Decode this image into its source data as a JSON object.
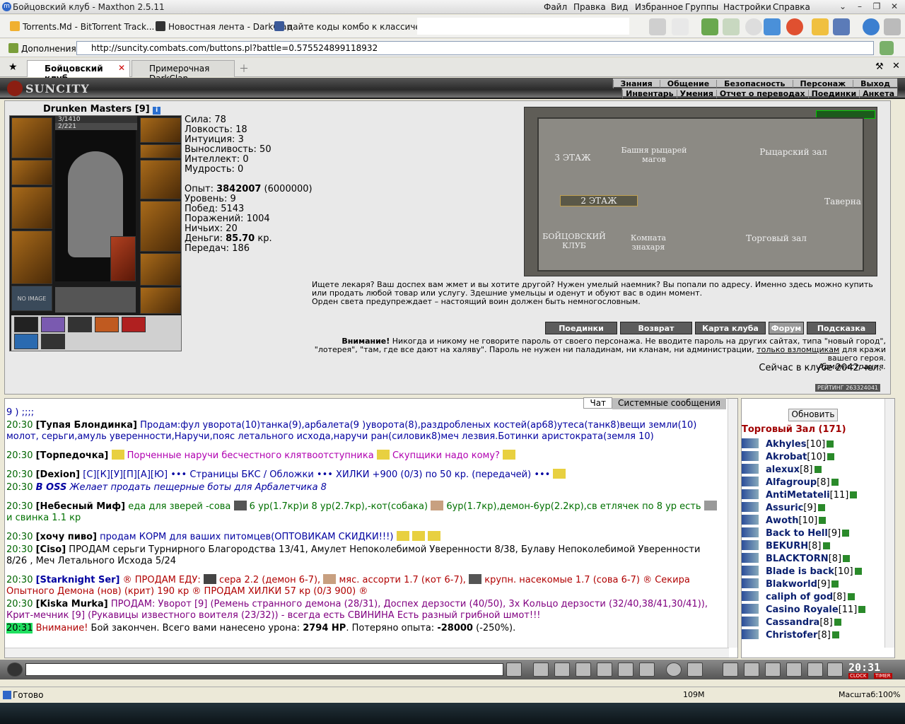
{
  "window": {
    "title": "Бойцовский клуб - Maxthon 2.5.11",
    "menu": [
      "Файл",
      "Правка",
      "Вид",
      "Избранное",
      "Группы",
      "Настройки",
      "Справка"
    ]
  },
  "favorites": [
    "Torrents.Md - BitTorrent Track...",
    "Новостная лента - DarkClan",
    "дайте коды комбо к классическо..."
  ],
  "addressbar": {
    "addons": "Дополнения",
    "url": "http://suncity.combats.com/buttons.pl?battle=0.575524899118932"
  },
  "tabs": [
    "Бойцовский клуб",
    "Примерочная DarkClan"
  ],
  "game": {
    "logo": "SUNCITY",
    "nav_top": [
      "Знания",
      "Общение",
      "Безопасность",
      "Персонаж",
      "Выход"
    ],
    "nav_sub": [
      "Инвентарь",
      "Умения",
      "Отчет о переводах",
      "Поединки",
      "Анкета"
    ]
  },
  "character": {
    "name": "Drunken Masters [9]",
    "hp": "3/1410",
    "mp": "2/221",
    "no_image": "NO IMAGE",
    "stats": [
      "Сила: 78",
      "Ловкость: 18",
      "Интуиция: 3",
      "Выносливость: 50",
      "Интеллект: 0",
      "Мудрость: 0"
    ],
    "exp_label": "Опыт: ",
    "exp_value": "3842007",
    "exp_next": " (6000000)",
    "level": "Уровень: 9",
    "wins": "Побед: 5143",
    "losses": "Поражений: 1004",
    "draws": "Ничьих: 20",
    "money_label": "Деньги: ",
    "money_value": "85.70",
    "money_unit": " кр.",
    "transfers": "Передач: 186"
  },
  "map": {
    "rooms": [
      "3 ЭТАЖ",
      "Башня рыцарей магов",
      "Рыцарский зал",
      "2 ЭТАЖ",
      "Таверна",
      "БОЙЦОВСКИЙ КЛУБ",
      "Комната знахаря",
      "Торговый зал"
    ]
  },
  "description": {
    "line1": "Ищете лекаря? Ваш доспех вам жмет и вы хотите другой? Нужен умелый наемник? Вы попали по адресу. Именно здесь можно купить или продать любой товар или услугу. Здешние умельцы и оденут и обуют вас в один момент.",
    "line2": "Орден света предупреждает – настоящий воин должен быть немногословным."
  },
  "buttons": [
    "Поединки",
    "Возврат",
    "Карта клуба",
    "Форум",
    "Подсказка"
  ],
  "warning": {
    "bold": "Внимание!",
    "text": " Никогда и никому не говорите пароль от своего персонажа. Не вводите пароль на других сайтах, типа \"новый город\", \"лотерея\", \"там, где все дают на халяву\". Пароль не нужен ни паладинам, ни кланам, ни администрации, ",
    "link": "только взломщикам",
    "tail": " для кражи вашего героя.",
    "sign": "Администрация."
  },
  "online": "Сейчас в клубе 2042 чел.",
  "rating": "РЕЙТИНГ 263324041",
  "chat": {
    "tabs": [
      "Чат",
      "Системные сообщения"
    ],
    "messages": [
      {
        "time": "",
        "nick": "",
        "text": "9 ) ;;;;"
      },
      {
        "time": "20:30",
        "nick": "[Тупая Блондинка]",
        "text": " Продам:фул уворота(10)танка(9),арбалета(9 )уворота(8),раздробленых костей(ар68)утеса(танк8)вещи земли(10) молот, серьги,амуль уверенности,Наручи,пояс летального исхода,наручи ран(силовик8)меч лезвия.Ботинки аристократа(земля 10)"
      },
      {
        "time": "20:30",
        "nick": "[Торпедочка]",
        "text": " Порченные наручи бесчестного клятвоотступника",
        "text2": " Скупщики надо кому?"
      },
      {
        "time": "20:30",
        "nick": "[Dexion]",
        "text": " [С][К][У][П][А][Ю] ••• Страницы БКС / Обложки ••• ХИЛКИ +900 (0/3) по 50 кр. (передачей) •••"
      },
      {
        "time": "20:30",
        "nick": "В OSS",
        "text": " Желает продать пещерные боты для Арбалетчика 8"
      },
      {
        "time": "20:30",
        "nick": "[Небесный Миф]",
        "text": " еда для зверей -сова",
        "text2": " 6 ур(1.7кр)и 8 ур(2.7кр),-кот(собака)",
        "text3": " 6ур(1.7кр),демон-6ур(2.2кр),св етлячек по 8 ур есть",
        "text4": " и свинка 1.1 кр"
      },
      {
        "time": "20:30",
        "nick": "[хочу пиво]",
        "text": " продам КОРМ для ваших питомцев(ОПТОВИКАМ СКИДКИ!!!)"
      },
      {
        "time": "20:30",
        "nick": "[Ciso]",
        "text": " ПРОДАМ серьги Турнирного Благородства 13/41, Амулет Непоколебимой Уверенности 8/38, Булаву Непоколебимой Уверенности 8/26 , Меч Летального Исхода 5/24"
      },
      {
        "time": "20:30",
        "nick": "[Starknight Ser]",
        "text": " ® ПРОДАМ ЕДУ:",
        "text2": " сера 2.2 (демон 6-7),",
        "text3": " мяс. ассорти 1.7 (кот 6-7),",
        "text4": " крупн. насекомые 1.7 (сова 6-7) ® Секира Опытного Демона (нов) (крит) 190 кр ® ПРОДАМ ХИЛКИ 57 кр (0/3 900) ®"
      },
      {
        "time": "20:30",
        "nick": "[Kiska Murka]",
        "text": " ПРОДАМ: Уворот [9] (Ремень странного демона (28/31), Доспех дерзости (40/50), 3х Кольцо дерзости (32/40,38/41,30/41)), Крит-мечник [9] (Рукавицы известного воителя (23/32)) - всегда есть СВИНИНА Есть разный грибной шмот!!!"
      },
      {
        "time": "20:31",
        "nick": "Внимание!",
        "text": " Бой закончен. Всего вами нанесено урона: ",
        "dmg": "2794 HP",
        "text2": ". Потеряно опыта: ",
        "exp": "-28000",
        "text3": " (-250%)."
      }
    ]
  },
  "sidebar": {
    "refresh": "Обновить",
    "room": "Торговый Зал (171)",
    "players": [
      [
        "Akhyles",
        "[10]"
      ],
      [
        "Akrobat",
        "[10]"
      ],
      [
        "alexux",
        "[8]"
      ],
      [
        "Alfagroup",
        "[8]"
      ],
      [
        "AntiMetateli",
        "[11]"
      ],
      [
        "Assuric",
        "[9]"
      ],
      [
        "Awoth",
        "[10]"
      ],
      [
        "Back to Hell",
        "[9]"
      ],
      [
        "BEKURH",
        "[8]"
      ],
      [
        "BLACKTORN",
        "[8]"
      ],
      [
        "Blade is back",
        "[10]"
      ],
      [
        "Blakworld",
        "[9]"
      ],
      [
        "caliph of god",
        "[8]"
      ],
      [
        "Casino Royale",
        "[11]"
      ],
      [
        "Cassandra",
        "[8]"
      ],
      [
        "Christofer",
        "[8]"
      ]
    ]
  },
  "bottom": {
    "clock": "20:31",
    "clock_label": "CLOCK",
    "timer_label": "TIMER"
  },
  "status": {
    "ready": "Готово",
    "mem": "109M",
    "zoom": "Масштаб:100%"
  },
  "colors": {
    "accent": "#2f66c8",
    "nick": "#0a1f6f",
    "chat_time": "#006400",
    "alert": "#b00000"
  }
}
